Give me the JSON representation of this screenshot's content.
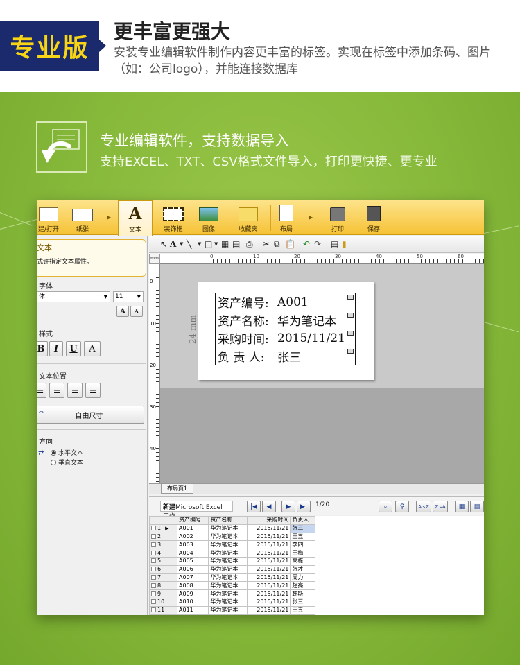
{
  "header": {
    "badge": "专业版",
    "title": "更丰富更强大",
    "description": "安装专业编辑软件制作内容更丰富的标签。实现在标签中添加条码、图片（如：公司logo），并能连接数据库"
  },
  "feature": {
    "title": "专业编辑软件，支持数据导入",
    "description": "支持EXCEL、TXT、CSV格式文件导入，打印更快捷、更专业"
  },
  "ribbon": {
    "items": [
      {
        "label": "建/打开"
      },
      {
        "label": "纸张"
      },
      {
        "label": "文本"
      },
      {
        "label": "装饰框"
      },
      {
        "label": "图像"
      },
      {
        "label": "收藏夹"
      },
      {
        "label": "布局"
      },
      {
        "label": "打印"
      },
      {
        "label": "保存"
      }
    ]
  },
  "left_panel": {
    "section_title": "文本",
    "section_desc": "式许指定文本属性。",
    "font_heading": "字体",
    "font_value": "体",
    "font_size": "11",
    "grow_font_label": "A",
    "shrink_font_label": "A",
    "style_heading": "样式",
    "bold_label": "B",
    "italic_label": "I",
    "underline_label": "U",
    "outline_label": "A",
    "position_heading": "文本位置",
    "autosize_label": "自由尺寸",
    "direction_heading": "方向",
    "horizontal_label": "水平文本",
    "vertical_label": "垂直文本"
  },
  "ruler": {
    "unit": "mm",
    "h_ticks": [
      "0",
      "10",
      "20",
      "30",
      "40",
      "50",
      "60"
    ],
    "v_ticks": [
      "0",
      "10",
      "20",
      "30",
      "40"
    ]
  },
  "label": {
    "size_note": "24 mm",
    "rows": [
      {
        "key": "资产编号:",
        "value": "A001"
      },
      {
        "key": "资产名称:",
        "value": "华为笔记本"
      },
      {
        "key": "采购时间:",
        "value": "2015/11/21"
      },
      {
        "key": "负 责 人:",
        "value": "张三"
      }
    ]
  },
  "page_tab": "布局页1",
  "database": {
    "new_button": "新建",
    "source_name": "Microsoft Excel 工作",
    "page_indicator": "1/20",
    "columns": [
      "资产编号",
      "资产名称",
      "采购时间",
      "负责人"
    ],
    "rows": [
      {
        "n": "1",
        "id": "A001",
        "name": "华为笔记本",
        "date": "2015/11/21",
        "owner": "张三"
      },
      {
        "n": "2",
        "id": "A002",
        "name": "华为笔记本",
        "date": "2015/11/21",
        "owner": "王五"
      },
      {
        "n": "3",
        "id": "A003",
        "name": "华为笔记本",
        "date": "2015/11/21",
        "owner": "李四"
      },
      {
        "n": "4",
        "id": "A004",
        "name": "华为笔记本",
        "date": "2015/11/21",
        "owner": "王梅"
      },
      {
        "n": "5",
        "id": "A005",
        "name": "华为笔记本",
        "date": "2015/11/21",
        "owner": "高栋"
      },
      {
        "n": "6",
        "id": "A006",
        "name": "华为笔记本",
        "date": "2015/11/21",
        "owner": "张才"
      },
      {
        "n": "7",
        "id": "A007",
        "name": "华为笔记本",
        "date": "2015/11/21",
        "owner": "周力"
      },
      {
        "n": "8",
        "id": "A008",
        "name": "华为笔记本",
        "date": "2015/11/21",
        "owner": "赵亮"
      },
      {
        "n": "9",
        "id": "A009",
        "name": "华为笔记本",
        "date": "2015/11/21",
        "owner": "韩斯"
      },
      {
        "n": "10",
        "id": "A010",
        "name": "华为笔记本",
        "date": "2015/11/21",
        "owner": "张三"
      },
      {
        "n": "11",
        "id": "A011",
        "name": "华为笔记本",
        "date": "2015/11/21",
        "owner": "王五"
      }
    ]
  },
  "colors": {
    "badge_bg": "#1a2a6c",
    "badge_text": "#f7d516",
    "green_bg": "#86b83a",
    "ribbon": "#f6c236"
  }
}
